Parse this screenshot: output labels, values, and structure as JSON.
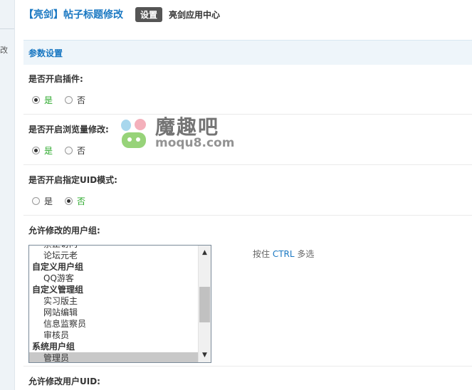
{
  "leftstrip": {
    "glyph": "改"
  },
  "header": {
    "title": "【亮剑】帖子标题修改",
    "active_tab": "设置",
    "link_tab": "亮剑应用中心"
  },
  "section": {
    "title": "参数设置"
  },
  "fields": {
    "enable_plugin": {
      "label": "是否开启插件:",
      "yes": "是",
      "no": "否",
      "selected": "yes"
    },
    "enable_views": {
      "label": "是否开启浏览量修改:",
      "yes": "是",
      "no": "否",
      "selected": "yes"
    },
    "enable_uid": {
      "label": "是否开启指定UID模式:",
      "yes": "是",
      "no": "否",
      "selected": "no"
    },
    "allowed_groups": {
      "label": "允许修改的用户组:",
      "hint_prefix": "按住 ",
      "hint_key": "CTRL",
      "hint_suffix": " 多选",
      "options": [
        {
          "text": "禁止访问",
          "type": "item"
        },
        {
          "text": "论坛元老",
          "type": "item"
        },
        {
          "text": "自定义用户组",
          "type": "group"
        },
        {
          "text": "QQ游客",
          "type": "item"
        },
        {
          "text": "自定义管理组",
          "type": "group"
        },
        {
          "text": "实习版主",
          "type": "item"
        },
        {
          "text": "网站编辑",
          "type": "item"
        },
        {
          "text": "信息监察员",
          "type": "item"
        },
        {
          "text": "审核员",
          "type": "item"
        },
        {
          "text": "系统用户组",
          "type": "group"
        },
        {
          "text": "管理员",
          "type": "item",
          "selected": true
        }
      ]
    },
    "allowed_uid": {
      "label": "允许修改用户UID:"
    }
  },
  "watermark": {
    "name": "魔趣吧",
    "domain": "moqu8.com",
    "icon": "moqu-logo-icon"
  },
  "colors": {
    "accent": "#1a78c2",
    "radio_on": "#2aa82a",
    "section_bg": "#eef5fa"
  }
}
